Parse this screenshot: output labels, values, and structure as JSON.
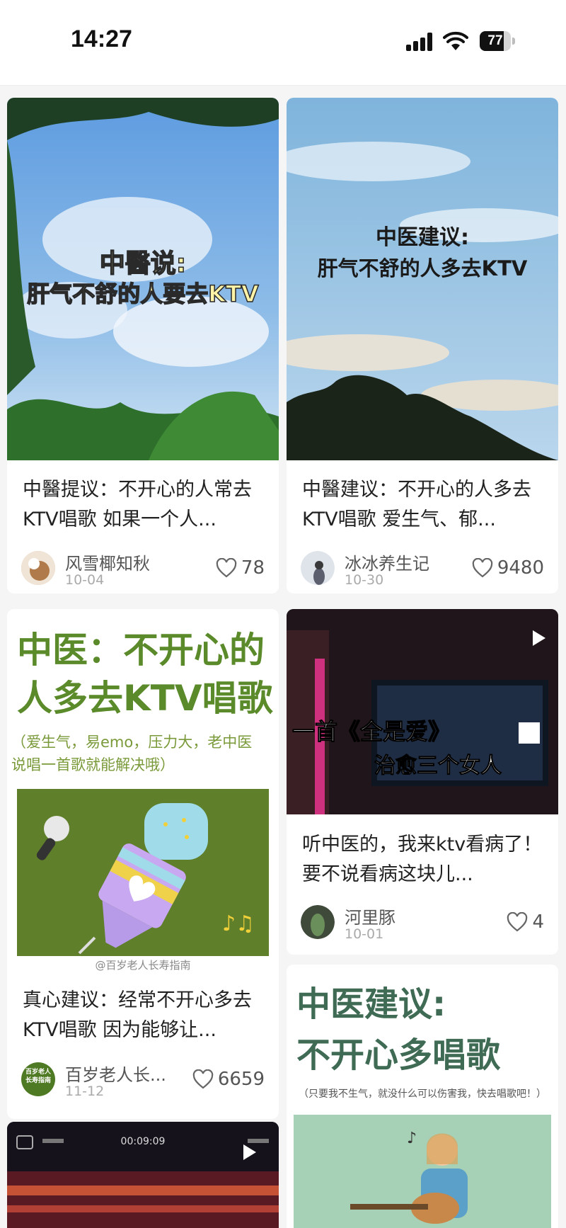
{
  "status_bar": {
    "time": "14:27",
    "battery": "77",
    "battery_level_pct": 77
  },
  "colors": {
    "green_title": "#5a8a2a",
    "deep_green": "#3f6b55",
    "heart": "#666666",
    "ktv_pink": "#e0338a"
  },
  "posts": [
    {
      "cover_line1": "中醫说:",
      "cover_line2": "肝气不舒的人要去KTV",
      "title": "中醫提议：不开心的人常去KTV唱歌 如果一个人...",
      "author": "风雪椰知秋",
      "date": "10-04",
      "likes": "78"
    },
    {
      "cover_line1": "中医建议:",
      "cover_line2": "肝气不舒的人多去KTV",
      "title": "中醫建议：不开心的人多去KTV唱歌 爱生气、郁...",
      "author": "冰冰养生记",
      "date": "10-30",
      "likes": "9480"
    },
    {
      "cover_line1": "中医：不开心的",
      "cover_line2": "人多去KTV唱歌",
      "cover_sub": "（爱生气，易emo，压力大，老中医说唱一首歌就能解决哦）",
      "cover_credit": "@百岁老人长寿指南",
      "title": "真心建议：经常不开心多去KTV唱歌 因为能够让...",
      "author": "百岁老人长...",
      "avatar_text": "百岁老人长寿指南",
      "date": "11-12",
      "likes": "6659"
    },
    {
      "cover_line1": "一首《全是爱》",
      "cover_line2": "治愈三个女人",
      "title": "听中医的，我来ktv看病了！ 要不说看病这块儿...",
      "author": "河里豚",
      "date": "10-01",
      "likes": "4"
    },
    {
      "cover_line1": "中医建议:",
      "cover_line2": "不开心多唱歌",
      "cover_sub": "（只要我不生气，就没什么可以伤害我，快去唱歌吧！）"
    },
    {
      "video_time": "00:09:09"
    }
  ]
}
